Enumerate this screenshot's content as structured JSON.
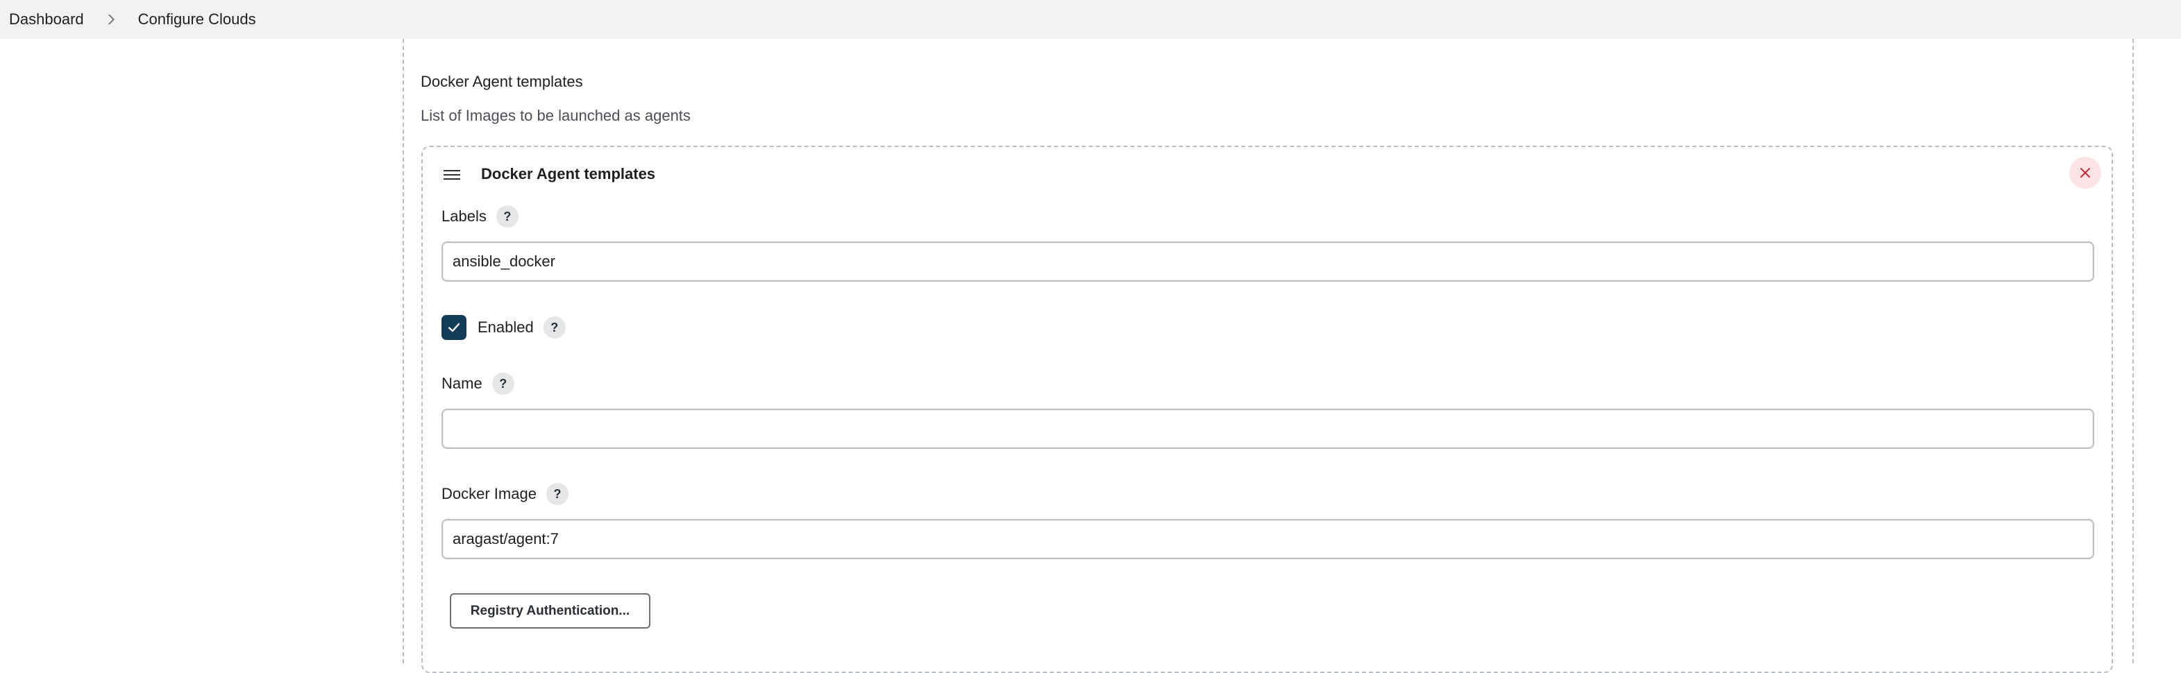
{
  "breadcrumb": {
    "items": [
      "Dashboard",
      "Configure Clouds"
    ],
    "separator_icon": "chevron-right-icon"
  },
  "section": {
    "title": "Docker Agent templates",
    "description": "List of Images to be launched as agents"
  },
  "template": {
    "title": "Docker Agent templates",
    "drag_icon": "hamburger-icon",
    "close_icon": "close-icon",
    "labels": {
      "label": "Labels",
      "value": "ansible_docker"
    },
    "enabled": {
      "label": "Enabled",
      "checked": true
    },
    "name": {
      "label": "Name",
      "value": ""
    },
    "docker_image": {
      "label": "Docker Image",
      "value": "aragast/agent:7"
    },
    "registry_button": "Registry Authentication...",
    "help_glyph": "?"
  },
  "colors": {
    "topbar_bg": "#f2f2f2",
    "checkbox_fill": "#123c5a",
    "close_bg": "#fbe3e6",
    "close_x": "#c8283c",
    "dashed_border": "#b8bcc4"
  }
}
